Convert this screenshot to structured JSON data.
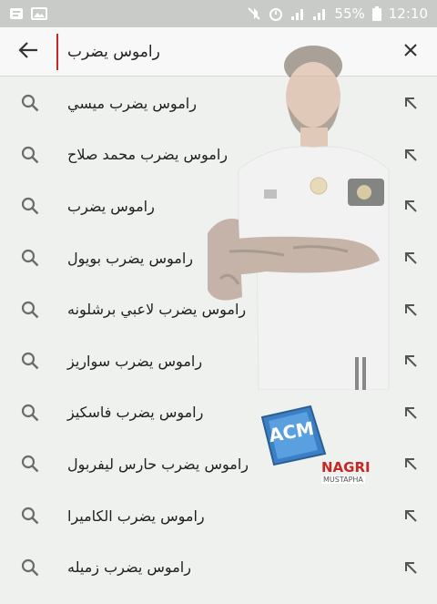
{
  "status_bar": {
    "battery_percent": "55%",
    "time": "12:10",
    "left_icons": [
      "notification-icon",
      "image-icon"
    ],
    "right_icons": [
      "mute-icon",
      "alarm-icon",
      "signal-icon",
      "signal-icon",
      "battery-icon"
    ]
  },
  "search": {
    "query": "راموس يضرب",
    "back_icon": "arrow-left-icon",
    "clear_icon": "close-icon"
  },
  "suggestions": [
    {
      "label": "راموس يضرب ميسي"
    },
    {
      "label": "راموس يضرب محمد صلاح"
    },
    {
      "label": "راموس يضرب"
    },
    {
      "label": "راموس يضرب بويول"
    },
    {
      "label": "راموس يضرب لاعبي برشلونه"
    },
    {
      "label": "راموس يضرب سواريز"
    },
    {
      "label": "راموس يضرب فاسكيز"
    },
    {
      "label": "راموس يضرب حارس ليفربول"
    },
    {
      "label": "راموس يضرب الكاميرا"
    },
    {
      "label": "راموس يضرب زميله"
    }
  ],
  "watermark": {
    "logo_text": "ACM",
    "name_line1": "NAGRI",
    "name_line2": "MUSTAPHA"
  },
  "colors": {
    "accent_cursor": "#c62828",
    "icon_gray": "#6b6b6b",
    "watermark_blue": "#3b7fc4",
    "watermark_red": "#c62828"
  }
}
